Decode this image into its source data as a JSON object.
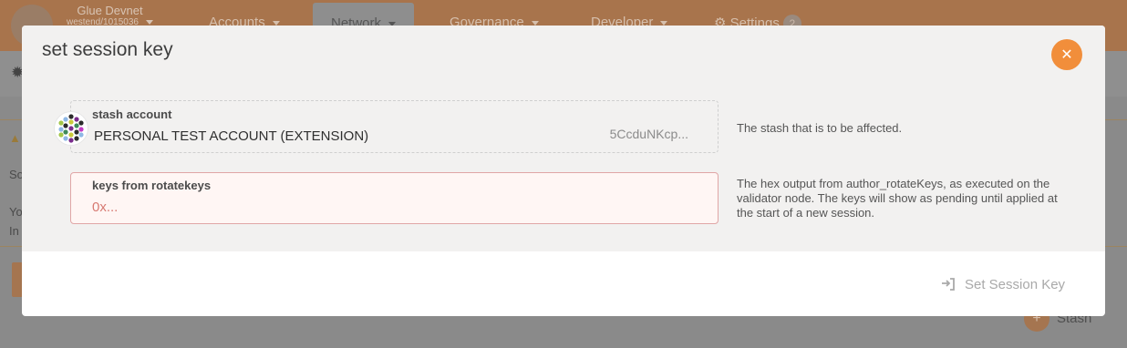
{
  "background": {
    "chain_name": "Glue Devnet",
    "chain_version": "westend/1015036",
    "nav": [
      {
        "label": "Accounts"
      },
      {
        "label": "Network"
      },
      {
        "label": "Governance"
      },
      {
        "label": "Developer"
      },
      {
        "label": "Settings"
      }
    ],
    "settings_badge": "2",
    "fragments": [
      "So",
      "Yo",
      "In"
    ],
    "stash_button": "Stash"
  },
  "modal": {
    "title": "set session key",
    "stash_field": {
      "label": "stash account",
      "value": "PERSONAL TEST ACCOUNT (EXTENSION)",
      "address": "5CcduNKcp..."
    },
    "stash_help": "The stash that is to be affected.",
    "keys_field": {
      "label": "keys from rotatekeys",
      "placeholder": "0x..."
    },
    "keys_help": "The hex output from author_rotateKeys, as executed on the validator node. The keys will show as pending until applied at the start of a new session.",
    "submit_label": "Set Session Key"
  },
  "colors": {
    "accent": "#f18e3b",
    "error_border": "#e0a6a6",
    "error_text": "#d9534f"
  },
  "icons": {
    "close": "close-icon",
    "submit": "sign-in-icon",
    "avatar": "identicon"
  }
}
